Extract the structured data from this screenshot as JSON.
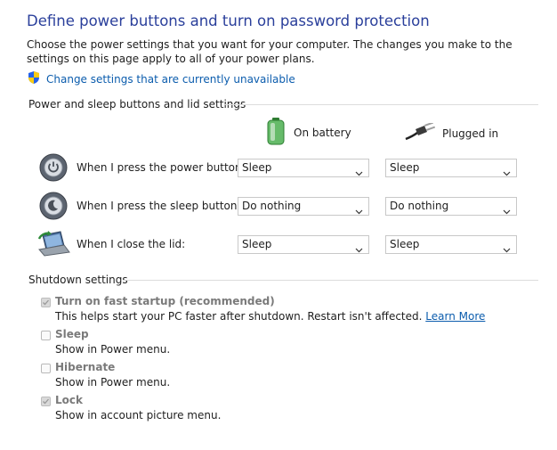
{
  "page": {
    "title": "Define power buttons and turn on password protection",
    "intro": "Choose the power settings that you want for your computer. The changes you make to the settings on this page apply to all of your power plans.",
    "change_link": "Change settings that are currently unavailable"
  },
  "power_section": {
    "heading": "Power and sleep buttons and lid settings",
    "columns": {
      "battery": "On battery",
      "plugged": "Plugged in"
    },
    "rows": [
      {
        "label": "When I press the power button:",
        "battery": "Sleep",
        "plugged": "Sleep"
      },
      {
        "label": "When I press the sleep button:",
        "battery": "Do nothing",
        "plugged": "Do nothing"
      },
      {
        "label": "When I close the lid:",
        "battery": "Sleep",
        "plugged": "Sleep"
      }
    ]
  },
  "shutdown_section": {
    "heading": "Shutdown settings",
    "options": [
      {
        "label": "Turn on fast startup (recommended)",
        "desc": "This helps start your PC faster after shutdown. Restart isn't affected.",
        "link": "Learn More",
        "checked": true
      },
      {
        "label": "Sleep",
        "desc": "Show in Power menu.",
        "checked": false
      },
      {
        "label": "Hibernate",
        "desc": "Show in Power menu.",
        "checked": false
      },
      {
        "label": "Lock",
        "desc": "Show in account picture menu.",
        "checked": true
      }
    ]
  },
  "colors": {
    "title": "#2a3f9b",
    "link": "#0b5cad",
    "disabled_text": "#7a7a7a"
  },
  "icons": {
    "shield": "uac-shield-icon",
    "battery": "battery-icon",
    "plug": "plug-icon",
    "power_button": "power-button-icon",
    "sleep_button": "sleep-button-icon",
    "lid": "laptop-lid-icon"
  }
}
